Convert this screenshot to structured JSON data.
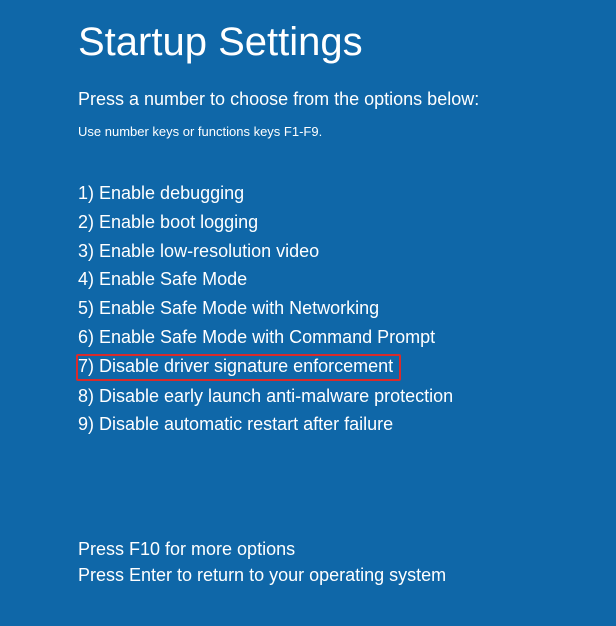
{
  "title": "Startup Settings",
  "subtitle": "Press a number to choose from the options below:",
  "hint": "Use number keys or functions keys F1-F9.",
  "options": [
    {
      "label": "1) Enable debugging",
      "highlighted": false
    },
    {
      "label": "2) Enable boot logging",
      "highlighted": false
    },
    {
      "label": "3) Enable low-resolution video",
      "highlighted": false
    },
    {
      "label": "4) Enable Safe Mode",
      "highlighted": false
    },
    {
      "label": "5) Enable Safe Mode with Networking",
      "highlighted": false
    },
    {
      "label": "6) Enable Safe Mode with Command Prompt",
      "highlighted": false
    },
    {
      "label": "7) Disable driver signature enforcement",
      "highlighted": true
    },
    {
      "label": "8) Disable early launch anti-malware protection",
      "highlighted": false
    },
    {
      "label": "9) Disable automatic restart after failure",
      "highlighted": false
    }
  ],
  "footer": {
    "more_options": "Press F10 for more options",
    "return_text": "Press Enter to return to your operating system"
  },
  "colors": {
    "background": "#0f67a8",
    "text": "#ffffff",
    "highlight_border": "#d92b2b"
  }
}
